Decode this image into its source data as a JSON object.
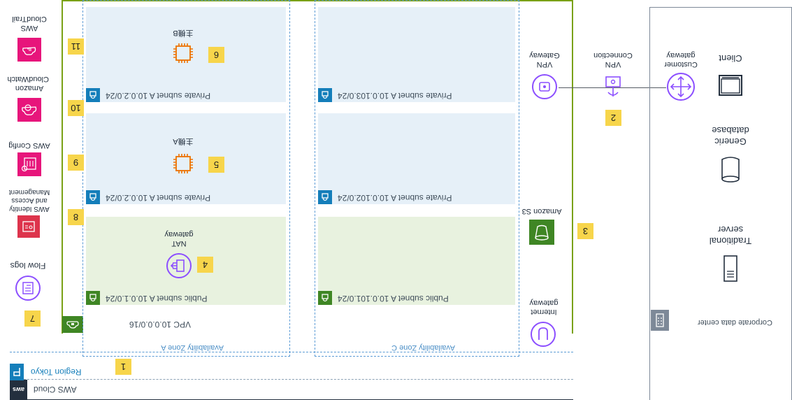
{
  "aws_cloud": {
    "label": "AWS Cloud",
    "logo_text": "aws"
  },
  "region": {
    "label": "Region Tokyo"
  },
  "vpc": {
    "label": "VPC 10.0.0.0/16"
  },
  "availability_zones": [
    "Availability Zone A",
    "Availability Zone C"
  ],
  "subnets": {
    "public_a": "Public subnet A 10.0.1.0/24",
    "public_c": "Public subnet A 10.0.101.0/24",
    "private1_a": "Private subnet A 10.0.2.0/24",
    "private1_c": "Private subnet A 10.0.102.0/24",
    "private2_a": "Private subnet A 10.0.2.0/24",
    "private2_c": "Private subnet A 10.0.103.0/24"
  },
  "nodes": {
    "nat_gateway": "NAT gateway",
    "server_a": "主機A",
    "server_b": "主機B",
    "internet_gateway": "Internet gateway",
    "amazon_s3": "Amazon S3",
    "vpn_gateway": "VPN Gateway",
    "vpn_connection": "VPN Connection",
    "customer_gateway": "Customer gateway",
    "client": "Client",
    "generic_database": "Generic database",
    "traditional_server": "Traditional server",
    "corporate_data_center": "Corporate data center"
  },
  "services": {
    "flow_logs": "Flow logs",
    "iam": "AWS Identity and Access Management",
    "config": "AWS Config",
    "cloudwatch": "Amazon CloudWatch",
    "cloudtrail": "AWS CloudTrail"
  },
  "markers": [
    "1",
    "2",
    "3",
    "4",
    "5",
    "6",
    "7",
    "8",
    "9",
    "10",
    "11"
  ],
  "colors": {
    "vpc_border": "#7aa116",
    "public_fill": "#e8f2df",
    "private_fill": "#e6f0f8",
    "az_border": "#5b9bd5",
    "marker": "#f7d54b",
    "purple": "#8c4fff",
    "orange": "#ed7100",
    "security_red": "#dd344c",
    "mgmt_pink": "#e7157b",
    "s3_green": "#7aa116",
    "tag_blue": "#147eba"
  }
}
